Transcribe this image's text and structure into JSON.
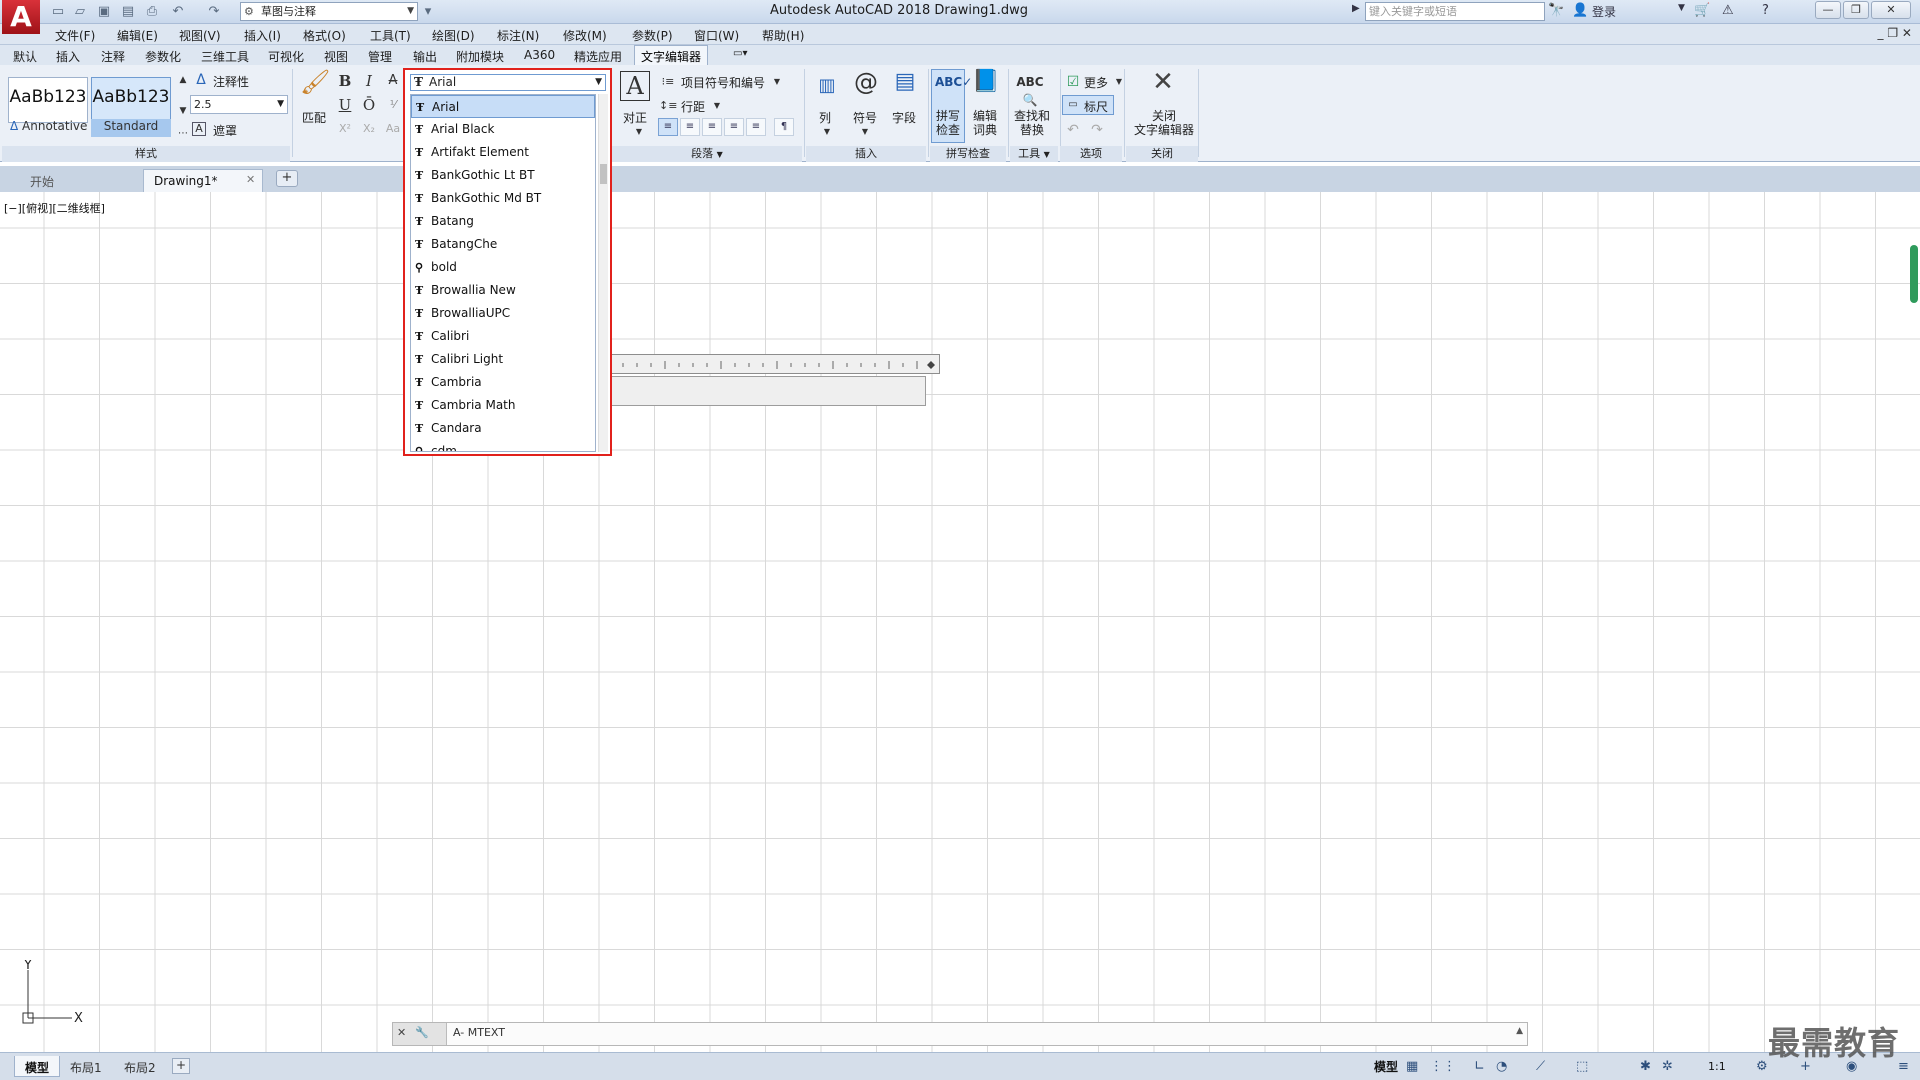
{
  "titlebar": {
    "app_logo": "A",
    "workspace": "草图与注释",
    "window_title": "Autodesk AutoCAD 2018    Drawing1.dwg",
    "search_placeholder": "键入关键字或短语",
    "signin": "登录",
    "window_controls": [
      "—",
      "❐",
      "✕"
    ]
  },
  "menubar": {
    "items": [
      "文件(F)",
      "编辑(E)",
      "视图(V)",
      "插入(I)",
      "格式(O)",
      "工具(T)",
      "绘图(D)",
      "标注(N)",
      "修改(M)",
      "参数(P)",
      "窗口(W)",
      "帮助(H)"
    ],
    "mdi_controls": "_ ❐ ✕"
  },
  "ribbon_tabs": [
    "默认",
    "插入",
    "注释",
    "参数化",
    "三维工具",
    "可视化",
    "视图",
    "管理",
    "输出",
    "附加模块",
    "A360",
    "精选应用",
    "文字编辑器"
  ],
  "ribbon": {
    "style_panel": {
      "swatch1_text": "AaBb123",
      "swatch1_caption": "Annotative",
      "swatch2_text": "AaBb123",
      "swatch2_caption": "Standard",
      "annotative_label": "注释性",
      "height_value": "2.5",
      "mask_label": "遮罩",
      "label": "样式"
    },
    "format_panel": {
      "match_label": "匹配",
      "bold": "B",
      "italic": "I",
      "underline": "U",
      "overline": "Ō"
    },
    "paragraph_panel": {
      "justify_label": "对正",
      "bullets_label": "项目符号和编号",
      "line_spacing_label": "行距",
      "label": "段落"
    },
    "insert_panel": {
      "columns_label": "列",
      "symbol_label": "符号",
      "field_label": "字段",
      "label": "插入"
    },
    "spell_panel": {
      "spell_check_label": "拼写\n检查",
      "edit_dict_label": "编辑\n词典",
      "label": "拼写检查"
    },
    "tools_panel": {
      "find_replace_label": "查找和\n替换",
      "label": "工具"
    },
    "options_panel": {
      "more_label": "更多",
      "ruler_label": "标尺",
      "label": "选项"
    },
    "close_panel": {
      "close_label": "关闭\n文字编辑器",
      "label": "关闭"
    }
  },
  "font_dropdown": {
    "current": "Arial",
    "items": [
      {
        "name": "Arial",
        "icon": "truetype-icon",
        "selected": true
      },
      {
        "name": "Arial Black",
        "icon": "truetype-icon"
      },
      {
        "name": "Artifakt Element",
        "icon": "truetype-icon"
      },
      {
        "name": "BankGothic Lt BT",
        "icon": "truetype-icon"
      },
      {
        "name": "BankGothic Md BT",
        "icon": "truetype-icon"
      },
      {
        "name": "Batang",
        "icon": "truetype-icon"
      },
      {
        "name": "BatangChe",
        "icon": "truetype-icon"
      },
      {
        "name": "bold",
        "icon": "shx-font-icon"
      },
      {
        "name": "Browallia New",
        "icon": "truetype-icon"
      },
      {
        "name": "BrowalliaUPC",
        "icon": "truetype-icon"
      },
      {
        "name": "Calibri",
        "icon": "truetype-icon"
      },
      {
        "name": "Calibri Light",
        "icon": "truetype-icon"
      },
      {
        "name": "Cambria",
        "icon": "truetype-icon"
      },
      {
        "name": "Cambria Math",
        "icon": "truetype-icon"
      },
      {
        "name": "Candara",
        "icon": "truetype-icon"
      },
      {
        "name": "cdm",
        "icon": "shx-font-icon"
      }
    ]
  },
  "doc_tabs": {
    "start": "开始",
    "drawing": "Drawing1*",
    "add": "+"
  },
  "viewport_label": "[−][俯视][二维线框]",
  "ucs": {
    "x": "X",
    "y": "Y"
  },
  "command_line": {
    "prompt": "A- MTEXT"
  },
  "statusbar": {
    "layouts": [
      "模型",
      "布局1",
      "布局2"
    ],
    "model_label": "模型",
    "scale": "1:1"
  },
  "watermark": "最需教育",
  "colors": {
    "highlight_border": "#e1211c",
    "accent": "#6f9bd1",
    "scroll_green": "#2f9b5c"
  }
}
